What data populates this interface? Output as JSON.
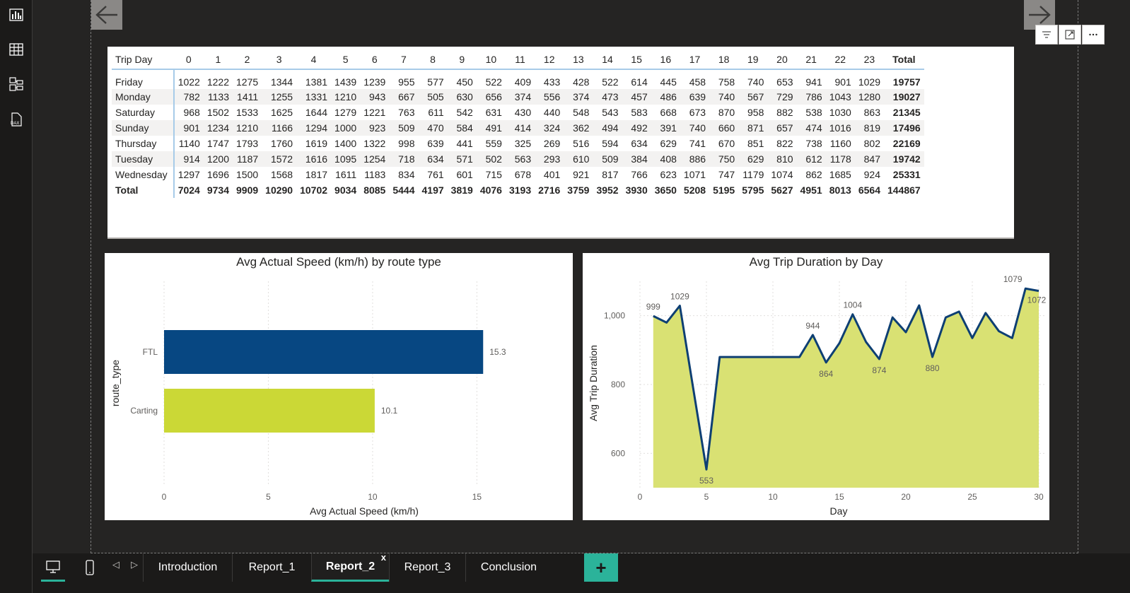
{
  "rail": {
    "icons": [
      "report-view-icon",
      "table-view-icon",
      "model-view-icon",
      "dax-query-icon"
    ]
  },
  "matrix": {
    "row_header": "Trip Day",
    "columns": [
      "0",
      "1",
      "2",
      "3",
      "4",
      "5",
      "6",
      "7",
      "8",
      "9",
      "10",
      "11",
      "12",
      "13",
      "14",
      "15",
      "16",
      "17",
      "18",
      "19",
      "20",
      "21",
      "22",
      "23",
      "Total"
    ],
    "rows": [
      {
        "label": "Friday",
        "values": [
          "1022",
          "1222",
          "1275",
          "1344",
          "1381",
          "1439",
          "1239",
          "955",
          "577",
          "450",
          "522",
          "409",
          "433",
          "428",
          "522",
          "614",
          "445",
          "458",
          "758",
          "740",
          "653",
          "941",
          "901",
          "1029",
          "19757"
        ]
      },
      {
        "label": "Monday",
        "values": [
          "782",
          "1133",
          "1411",
          "1255",
          "1331",
          "1210",
          "943",
          "667",
          "505",
          "630",
          "656",
          "374",
          "556",
          "374",
          "473",
          "457",
          "486",
          "639",
          "740",
          "567",
          "729",
          "786",
          "1043",
          "1280",
          "19027"
        ]
      },
      {
        "label": "Saturday",
        "values": [
          "968",
          "1502",
          "1533",
          "1625",
          "1644",
          "1279",
          "1221",
          "763",
          "611",
          "542",
          "631",
          "430",
          "440",
          "548",
          "543",
          "583",
          "668",
          "673",
          "870",
          "958",
          "882",
          "538",
          "1030",
          "863",
          "21345"
        ]
      },
      {
        "label": "Sunday",
        "values": [
          "901",
          "1234",
          "1210",
          "1166",
          "1294",
          "1000",
          "923",
          "509",
          "470",
          "584",
          "491",
          "414",
          "324",
          "362",
          "494",
          "492",
          "391",
          "740",
          "660",
          "871",
          "657",
          "474",
          "1016",
          "819",
          "17496"
        ]
      },
      {
        "label": "Thursday",
        "values": [
          "1140",
          "1747",
          "1793",
          "1760",
          "1619",
          "1400",
          "1322",
          "998",
          "639",
          "441",
          "559",
          "325",
          "269",
          "516",
          "594",
          "634",
          "629",
          "741",
          "670",
          "851",
          "822",
          "738",
          "1160",
          "802",
          "22169"
        ]
      },
      {
        "label": "Tuesday",
        "values": [
          "914",
          "1200",
          "1187",
          "1572",
          "1616",
          "1095",
          "1254",
          "718",
          "634",
          "571",
          "502",
          "563",
          "293",
          "610",
          "509",
          "384",
          "408",
          "886",
          "750",
          "629",
          "810",
          "612",
          "1178",
          "847",
          "19742"
        ]
      },
      {
        "label": "Wednesday",
        "values": [
          "1297",
          "1696",
          "1500",
          "1568",
          "1817",
          "1611",
          "1183",
          "834",
          "761",
          "601",
          "715",
          "678",
          "401",
          "921",
          "817",
          "766",
          "623",
          "1071",
          "747",
          "1179",
          "1074",
          "862",
          "1685",
          "924",
          "25331"
        ]
      }
    ],
    "total": {
      "label": "Total",
      "values": [
        "7024",
        "9734",
        "9909",
        "10290",
        "10702",
        "9034",
        "8085",
        "5444",
        "4197",
        "3819",
        "4076",
        "3193",
        "2716",
        "3759",
        "3952",
        "3930",
        "3650",
        "5208",
        "5195",
        "5795",
        "5627",
        "4951",
        "8013",
        "6564",
        "144867"
      ]
    }
  },
  "chart_data": [
    {
      "type": "bar",
      "orientation": "horizontal",
      "title": "Avg Actual Speed (km/h) by route type",
      "xlabel": "Avg Actual Speed (km/h)",
      "ylabel": "route_type",
      "categories": [
        "FTL",
        "Carting"
      ],
      "values": [
        15.3,
        10.1
      ],
      "value_labels": [
        "15.3",
        "10.1"
      ],
      "colors": [
        "#074782",
        "#cbd836"
      ],
      "xlim": [
        0,
        15.8
      ],
      "xticks": [
        "0",
        "5",
        "10",
        "15"
      ],
      "grid": true
    },
    {
      "type": "area",
      "title": "Avg Trip Duration by Day",
      "xlabel": "Day",
      "ylabel": "Avg Trip Duration",
      "x": [
        1,
        2,
        3,
        4,
        5,
        6,
        7,
        8,
        9,
        10,
        11,
        12,
        13,
        14,
        15,
        16,
        17,
        18,
        19,
        20,
        21,
        22,
        23,
        24,
        25,
        26,
        27,
        28,
        29,
        30
      ],
      "y": [
        999,
        980,
        1029,
        790,
        553,
        880,
        880,
        880,
        880,
        880,
        880,
        880,
        944,
        864,
        920,
        1004,
        924,
        874,
        995,
        952,
        1030,
        880,
        995,
        1012,
        935,
        1008,
        955,
        935,
        1079,
        1072
      ],
      "labels": [
        {
          "x": 1,
          "text": "999"
        },
        {
          "x": 3,
          "text": "1029"
        },
        {
          "x": 5,
          "text": "553"
        },
        {
          "x": 13,
          "text": "944"
        },
        {
          "x": 14,
          "text": "864"
        },
        {
          "x": 16,
          "text": "1004"
        },
        {
          "x": 18,
          "text": "874"
        },
        {
          "x": 22,
          "text": "880"
        },
        {
          "x": 29,
          "text": "1079"
        },
        {
          "x": 30,
          "text": "1072"
        }
      ],
      "xlim": [
        0,
        30
      ],
      "ylim": [
        500,
        1100
      ],
      "xticks": [
        "0",
        "5",
        "10",
        "15",
        "20",
        "25",
        "30"
      ],
      "yticks": [
        {
          "v": 600,
          "t": "600"
        },
        {
          "v": 800,
          "t": "800"
        },
        {
          "v": 1000,
          "t": "1,000"
        }
      ],
      "line_color": "#0e3f73",
      "fill_color": "#d9e173",
      "grid": true
    }
  ],
  "tabs": {
    "pages": [
      "Introduction",
      "Report_1",
      "Report_2",
      "Report_3",
      "Conclusion"
    ],
    "active": "Report_2",
    "close_glyph": "x",
    "add_glyph": "+",
    "prev_glyph": "◁",
    "next_glyph": "▷"
  },
  "colors": {
    "accent": "#2bb39a",
    "background": "#252423"
  }
}
